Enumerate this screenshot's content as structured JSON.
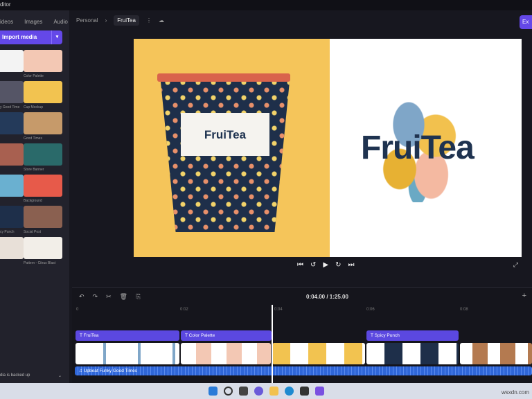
{
  "window": {
    "title": "ditor"
  },
  "sidebar": {
    "tabs": [
      "ideos",
      "Images",
      "Audio"
    ],
    "import_label": "Import media",
    "import_dropdown": "▾",
    "media": [
      {
        "label": "",
        "color": "#f3f3f3"
      },
      {
        "label": "Color Palette",
        "color": "#f3c8b4"
      },
      {
        "label": "y Good Time",
        "color": "#555566"
      },
      {
        "label": "Cup Mockup",
        "color": "#f2c350"
      },
      {
        "label": "",
        "color": "#243a5a"
      },
      {
        "label": "Good Times",
        "color": "#c69a6a"
      },
      {
        "label": "",
        "color": "#a86050"
      },
      {
        "label": "Store Banner",
        "color": "#2a6a6a"
      },
      {
        "label": "",
        "color": "#6ab0d0"
      },
      {
        "label": "Background",
        "color": "#e75a4a"
      },
      {
        "label": "cy Punch",
        "color": "#1e2f4a"
      },
      {
        "label": "Social Post",
        "color": "#8a6050"
      },
      {
        "label": "",
        "color": "#e8e0d8"
      },
      {
        "label": "Pattern - Citrus Blast",
        "color": "#f2eee8"
      }
    ],
    "backup_label": "dia is backed up",
    "backup_chevron": "⌄"
  },
  "header": {
    "breadcrumb_parent": "Personal",
    "breadcrumb_sep": "›",
    "project": "FruiTea",
    "more": "⋮",
    "cloud": "☁",
    "export_label": "Ex"
  },
  "preview": {
    "cup_label": "FruiTea",
    "logo": "FruiTea"
  },
  "player": {
    "skip_back": "⏮",
    "rewind": "↺",
    "play": "▶",
    "forward": "↻",
    "skip_fwd": "⏭",
    "fullscreen": "⤢"
  },
  "timeline": {
    "tools": [
      "↶",
      "↷",
      "✂",
      "🗑",
      "⎘"
    ],
    "time": "0:04.00 / 1:25.00",
    "add": "+",
    "ticks": [
      "0",
      "0:02",
      "0:04",
      "0:06",
      "0:08"
    ],
    "text_clips": [
      "FruiTea",
      "Color Palette",
      "Spicy Punch"
    ],
    "audio": "Upbeat Funky Good Times"
  },
  "taskbar": {
    "watermark": "wsxdn.com"
  }
}
